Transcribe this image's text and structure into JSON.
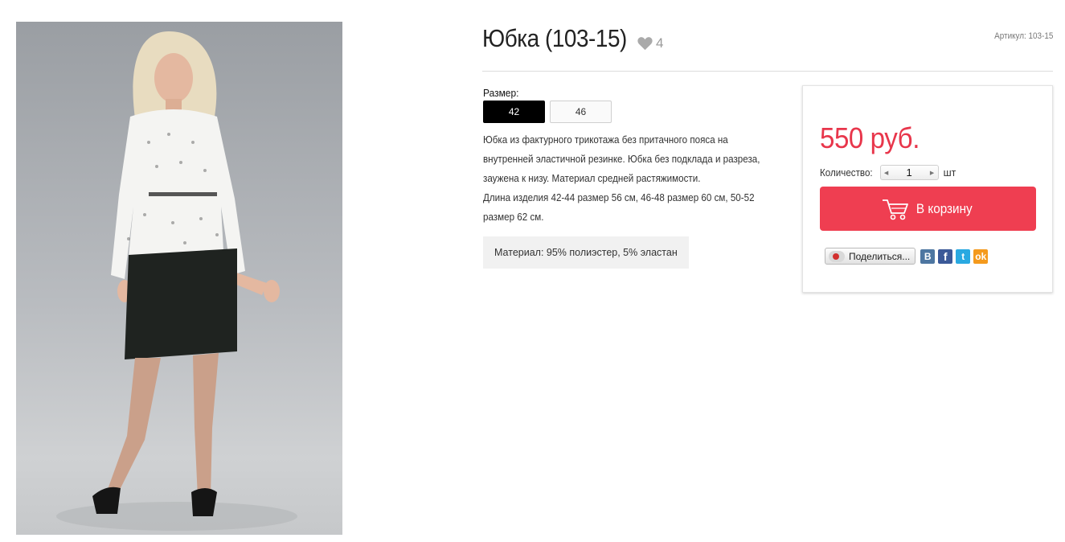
{
  "product": {
    "title": "Юбка (103-15)",
    "likes": "4",
    "sku": "Артикул: 103-15",
    "photo_alt": ""
  },
  "sizes": {
    "label": "Размер:",
    "options": [
      "42",
      "46"
    ],
    "selected": "42"
  },
  "description": {
    "lines": [
      "Юбка из фактурного трикотажа без притачного пояса на",
      "внутренней эластичной резинке. Юбка без подклада и разреза,",
      "заужена к низу. Материал средней растяжимости.",
      "Длина изделия 42-44 размер 56 см, 46-48 размер 60 см, 50-52",
      "размер 62 см."
    ],
    "material": "Материал: 95% полиэстер, 5% эластан"
  },
  "buy": {
    "price": "550 руб.",
    "qty_label": "Количество:",
    "qty_value": "1",
    "qty_unit": "шт",
    "cart_label": "В корзину",
    "share_label": "Поделиться...",
    "vk_glyph": "B",
    "fb_glyph": "f",
    "tw_glyph": "t",
    "ok_glyph": "ok"
  },
  "colors": {
    "accent": "#ef3e51",
    "price": "#e8364b",
    "size_active_bg": "#000000"
  },
  "icons": [
    "heart-icon",
    "cart-icon",
    "share-icon",
    "vk-icon",
    "facebook-icon",
    "twitter-icon",
    "odnoklassniki-icon"
  ]
}
